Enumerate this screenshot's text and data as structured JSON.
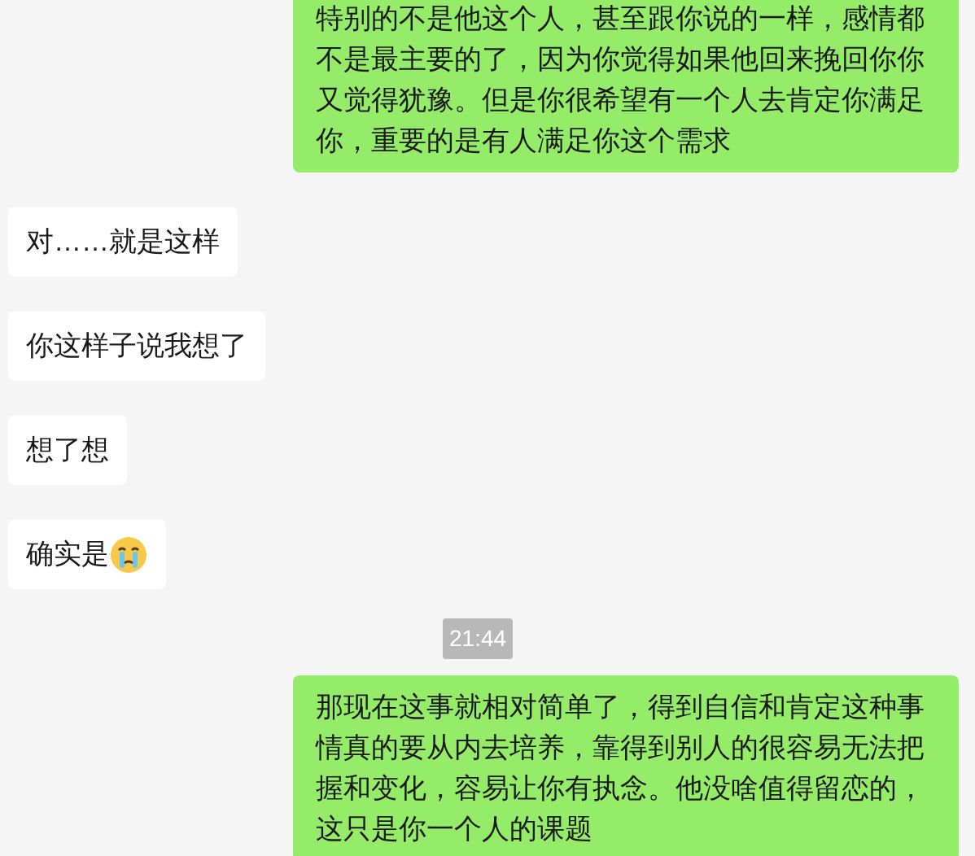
{
  "messages": [
    {
      "kind": "sent",
      "text": "特别的不是他这个人，甚至跟你说的一样，感情都不是最主要的了，因为你觉得如果他回来挽回你你又觉得犹豫。但是你很希望有一个人去肯定你满足你，重要的是有人满足你这个需求"
    },
    {
      "kind": "received",
      "text": "对……就是这样"
    },
    {
      "kind": "received",
      "text": "你这样子说我想了"
    },
    {
      "kind": "received",
      "text": "想了想"
    },
    {
      "kind": "received",
      "text": "确实是",
      "has_emoji": true
    },
    {
      "kind": "time",
      "text": "21:44"
    },
    {
      "kind": "sent",
      "text": "那现在这事就相对简单了，得到自信和肯定这种事情真的要从内去培养，靠得到别人的很容易无法把握和变化，容易让你有执念。他没啥值得留恋的，这只是你一个人的课题"
    }
  ]
}
